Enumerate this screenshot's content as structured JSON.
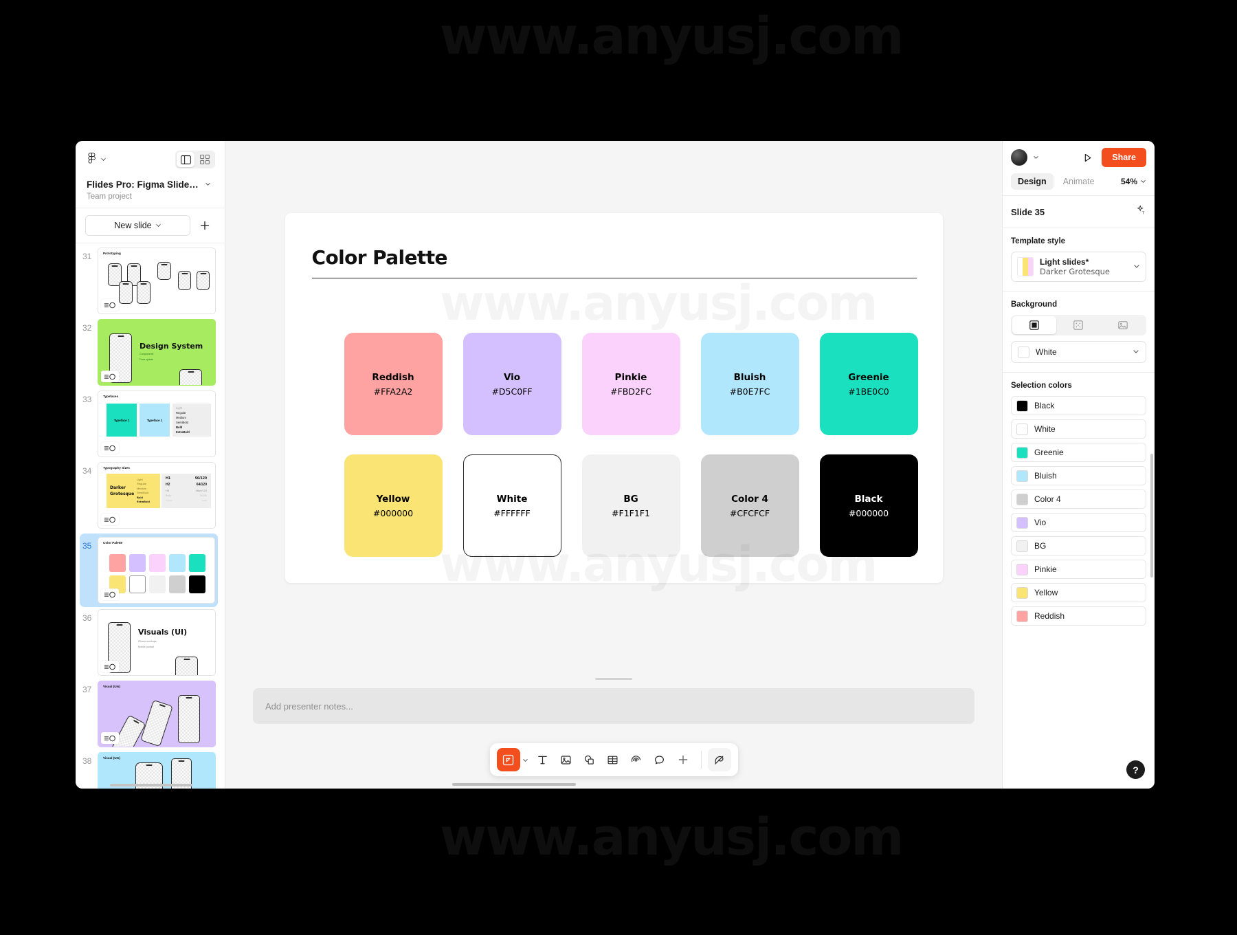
{
  "watermark": "www.anyusj.com",
  "left_panel": {
    "figma_logo_icon": "figma-logo-icon",
    "view_toggle": [
      {
        "icon": "panel-layout-icon",
        "active": true
      },
      {
        "icon": "grid-view-icon",
        "active": false
      }
    ],
    "file_title": "Flides Pro: Figma Slides Cas...",
    "team_label": "Team project",
    "new_slide_label": "New slide",
    "add_slide_icon": "plus-icon",
    "thumbnails": [
      {
        "number": "31",
        "title": "Prototyping",
        "bg": "#ffffff",
        "kind": "phones",
        "selected": false
      },
      {
        "number": "32",
        "title": "Design System",
        "bg": "#a6eb60",
        "kind": "title",
        "sub1": "Components",
        "sub2": "Docs update",
        "selected": false
      },
      {
        "number": "33",
        "title": "Typefaces",
        "bg": "#ffffff",
        "kind": "typefaces",
        "selected": false
      },
      {
        "number": "34",
        "title": "Typography Sizes",
        "bg": "#ffffff",
        "kind": "typo",
        "selected": false
      },
      {
        "number": "35",
        "title": "Color Palette",
        "bg": "#ffffff",
        "kind": "palette",
        "selected": true
      },
      {
        "number": "36",
        "title": "Visuals (UI)",
        "bg": "#ffffff",
        "kind": "title",
        "sub1": "iPhone mockups",
        "sub2": "Mobile portrait",
        "selected": false
      },
      {
        "number": "37",
        "title": "Visual (UIs)",
        "bg": "#d7c2fb",
        "kind": "phones-tilt",
        "selected": false
      },
      {
        "number": "38",
        "title": "Visual (UIs)",
        "bg": "#b0e7fc",
        "kind": "phones",
        "selected": false
      }
    ]
  },
  "slide": {
    "title": "Color Palette",
    "swatches": [
      {
        "name": "Reddish",
        "hex": "#FFA2A2",
        "bg": "#FFA2A2",
        "text": "#000000",
        "border": false
      },
      {
        "name": "Vio",
        "hex": "#D5C0FF",
        "bg": "#D5C0FF",
        "text": "#000000",
        "border": false
      },
      {
        "name": "Pinkie",
        "hex": "#FBD2FC",
        "bg": "#FBD2FC",
        "text": "#000000",
        "border": false
      },
      {
        "name": "Bluish",
        "hex": "#B0E7FC",
        "bg": "#B0E7FC",
        "text": "#000000",
        "border": false
      },
      {
        "name": "Greenie",
        "hex": "#1BE0C0",
        "bg": "#1BE0C0",
        "text": "#000000",
        "border": false
      },
      {
        "name": "Yellow",
        "hex": "#000000",
        "bg": "#F9E474",
        "text": "#000000",
        "border": false
      },
      {
        "name": "White",
        "hex": "#FFFFFF",
        "bg": "#FFFFFF",
        "text": "#000000",
        "border": true
      },
      {
        "name": "BG",
        "hex": "#F1F1F1",
        "bg": "#F1F1F1",
        "text": "#000000",
        "border": false
      },
      {
        "name": "Color 4",
        "hex": "#CFCFCF",
        "bg": "#CFCFCF",
        "text": "#000000",
        "border": false
      },
      {
        "name": "Black",
        "hex": "#000000",
        "bg": "#000000",
        "text": "#FFFFFF",
        "border": false
      }
    ]
  },
  "notes": {
    "placeholder": "Add presenter notes..."
  },
  "toolbar": {
    "items": [
      {
        "icon": "frame-slide-icon",
        "active": true
      },
      {
        "icon": "chevron-down-icon",
        "caret": true
      },
      {
        "icon": "text-icon",
        "active": false
      },
      {
        "icon": "image-icon",
        "active": false
      },
      {
        "icon": "shapes-icon",
        "active": false
      },
      {
        "icon": "table-icon",
        "active": false
      },
      {
        "icon": "sticker-icon",
        "active": false
      },
      {
        "icon": "comment-icon",
        "active": false
      },
      {
        "icon": "plus-icon",
        "active": false
      }
    ],
    "trailing": {
      "icon": "pen-draw-icon"
    }
  },
  "right_panel": {
    "avatar_icon": "user-avatar",
    "avatar_caret_icon": "chevron-down-icon",
    "present_icon": "play-icon",
    "share_label": "Share",
    "tabs": [
      {
        "label": "Design",
        "active": true
      },
      {
        "label": "Animate",
        "active": false
      }
    ],
    "zoom_level": "54%",
    "zoom_caret_icon": "chevron-down-icon",
    "slide_name": "Slide 35",
    "slide_magic_icon": "sparkle-text-icon",
    "template_style": {
      "label": "Template style",
      "name": "Light slides*",
      "font": "Darker Grotesque",
      "swatch_colors": [
        "#FFFFFF",
        "#F9E474",
        "#FBD2FC"
      ],
      "caret_icon": "chevron-down-icon"
    },
    "background": {
      "label": "Background",
      "tabs": [
        {
          "icon": "solid-fill-icon",
          "active": true
        },
        {
          "icon": "pattern-fill-icon",
          "active": false
        },
        {
          "icon": "image-fill-icon",
          "active": false
        }
      ],
      "value": "White",
      "value_color": "#FFFFFF",
      "caret_icon": "chevron-down-icon"
    },
    "selection_colors": {
      "label": "Selection colors",
      "items": [
        {
          "label": "Black",
          "color": "#000000"
        },
        {
          "label": "White",
          "color": "#FFFFFF"
        },
        {
          "label": "Greenie",
          "color": "#1BE0C0"
        },
        {
          "label": "Bluish",
          "color": "#B0E7FC"
        },
        {
          "label": "Color 4",
          "color": "#CFCFCF"
        },
        {
          "label": "Vio",
          "color": "#D5C0FF"
        },
        {
          "label": "BG",
          "color": "#F1F1F1"
        },
        {
          "label": "Pinkie",
          "color": "#FBD2FC"
        },
        {
          "label": "Yellow",
          "color": "#F9E474"
        },
        {
          "label": "Reddish",
          "color": "#FFA2A2"
        }
      ]
    },
    "help_label": "?"
  },
  "accent": "#F24E1E"
}
